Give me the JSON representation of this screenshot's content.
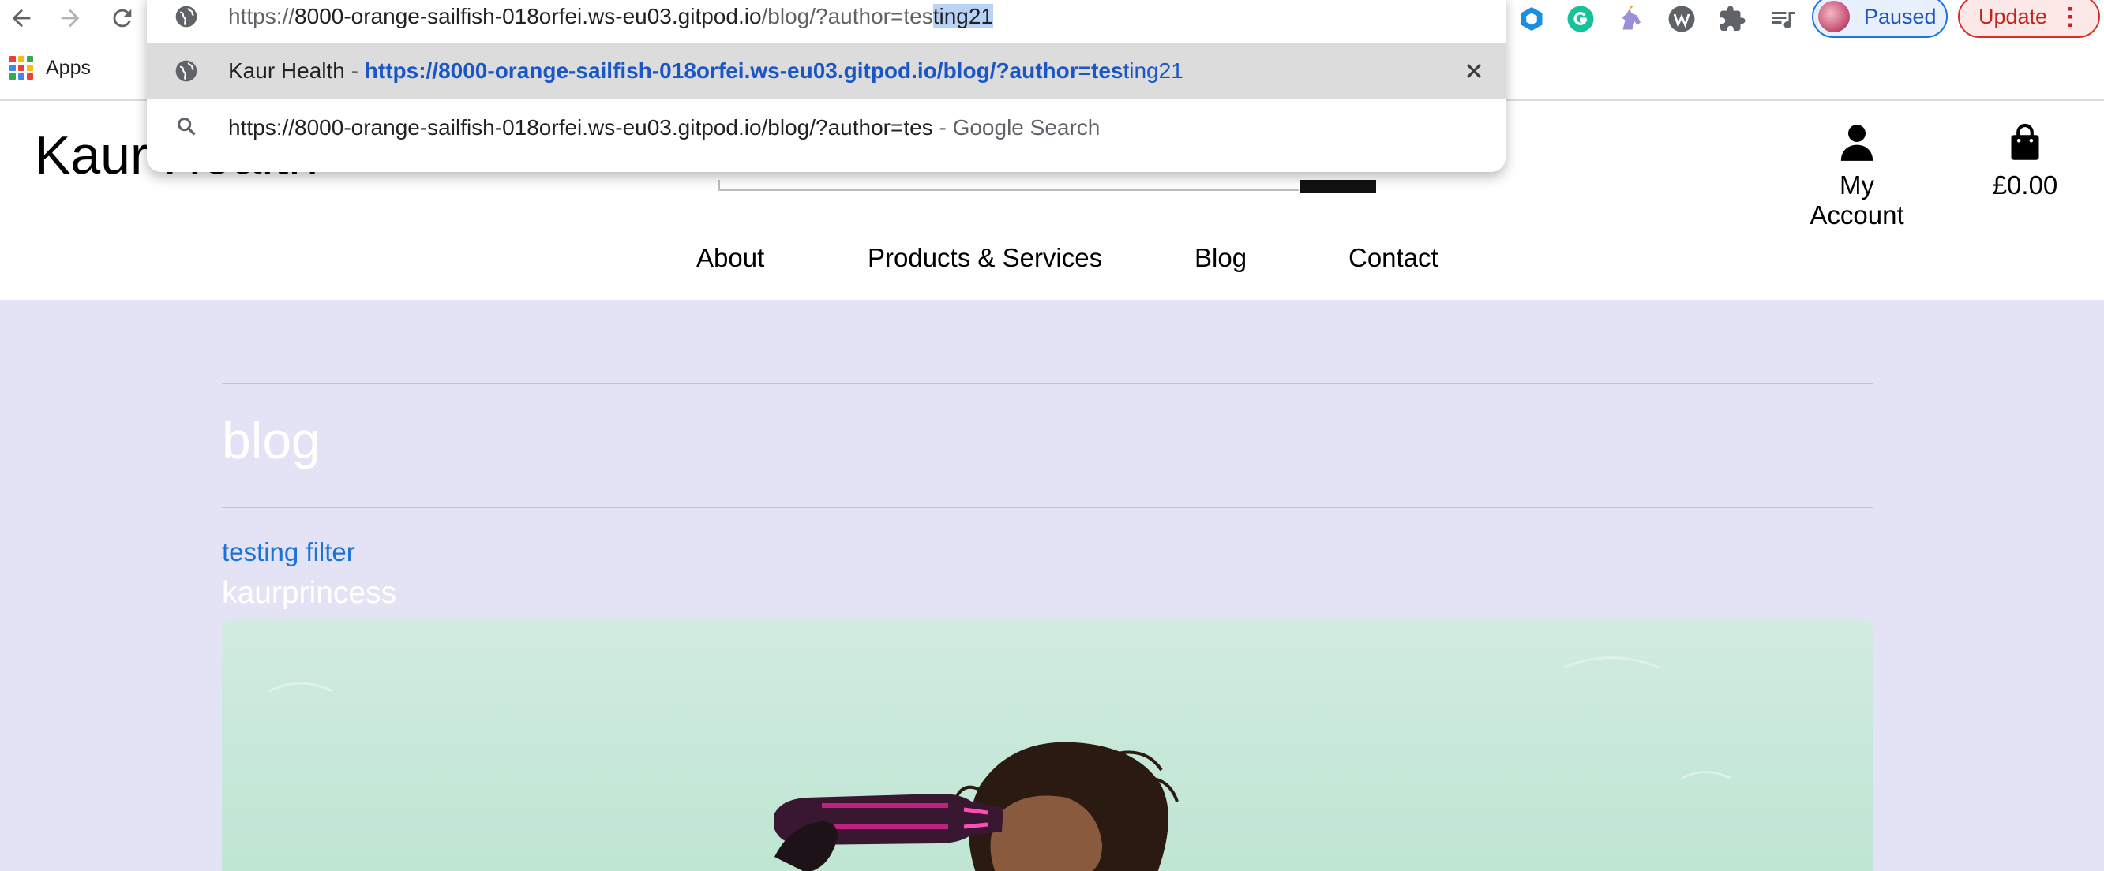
{
  "browser": {
    "nav": {
      "back_icon": "arrow-left-icon",
      "forward_icon": "arrow-right-icon",
      "reload_icon": "reload-icon"
    },
    "extensions": [
      "hexagon-extension-icon",
      "grammarly-icon",
      "unicorn-icon",
      "wordpress-icon",
      "puzzle-icon",
      "reading-list-icon"
    ],
    "profile": {
      "label": "Paused"
    },
    "update": {
      "label": "Update",
      "menu_icon": "vertical-dots-icon"
    },
    "bookmarks": {
      "apps_label": "Apps"
    }
  },
  "omnibox": {
    "input": {
      "prefix_dim": "https://",
      "domain": "8000-orange-sailfish-018orfei.ws-eu03.gitpod.io",
      "path_dim": "/blog/?author=tes",
      "selected": "ting21"
    },
    "suggestions": [
      {
        "title": "Kaur Health",
        "separator": " - ",
        "url_bold": "https://8000-orange-sailfish-018orfei.ws-eu03.gitpod.io/blog/?author=tes",
        "url_rest": "ting21",
        "icon": "globe-icon"
      },
      {
        "query": "https://8000-orange-sailfish-018orfei.ws-eu03.gitpod.io/blog/?author=tes",
        "engine": " - Google Search",
        "icon": "search-icon"
      }
    ]
  },
  "site": {
    "logo": "Kaur Health",
    "account_label": "My Account",
    "cart_total": "£0.00",
    "nav": [
      "About",
      "Products & Services",
      "Blog",
      "Contact"
    ]
  },
  "content": {
    "heading": "blog",
    "post": {
      "title": "testing filter",
      "author": "kaurprincess"
    }
  },
  "colors": {
    "content_bg": "#e4e3f6",
    "link": "#1a73d6",
    "accent_blue": "#1a73e8",
    "update_red": "#d93025"
  }
}
